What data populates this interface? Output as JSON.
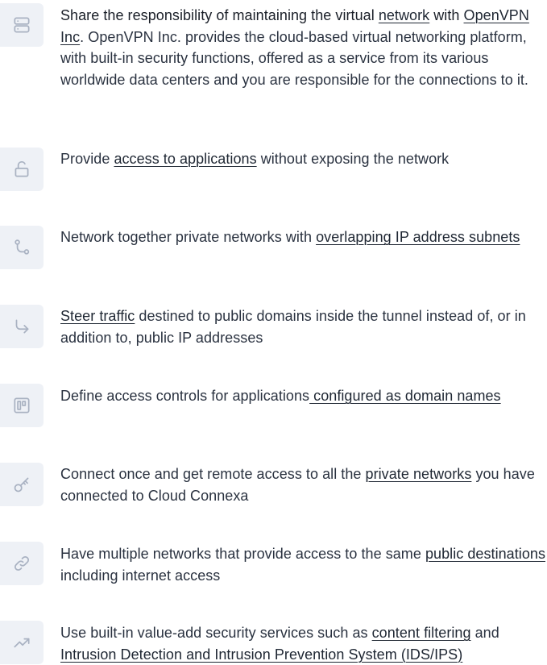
{
  "features": [
    {
      "icon": "server-icon",
      "parts": {
        "p1": "Share the responsibility of maintaining the virtual ",
        "l1": "network",
        "p2": " with ",
        "l2": "OpenVPN Inc",
        "p3": ". OpenVPN Inc. provides the cloud-based virtual networking platform, with built-in security functions, offered as a service from its various worldwide data centers and you are responsible for the connections to it."
      }
    },
    {
      "icon": "unlock-icon",
      "parts": {
        "p1": "Provide ",
        "l1": "access to applications",
        "p2": " without exposing the network"
      }
    },
    {
      "icon": "route-icon",
      "parts": {
        "p1": "Network together private networks with ",
        "l1": "overlapping IP address subnets"
      }
    },
    {
      "icon": "corner-down-right-icon",
      "parts": {
        "l1": "Steer traffic",
        "p1": " destined to public domains inside the tunnel instead of, or in addition to, public IP addresses"
      }
    },
    {
      "icon": "board-icon",
      "parts": {
        "p1": "Define access controls for applications",
        "l1": " configured as domain names"
      }
    },
    {
      "icon": "key-icon",
      "parts": {
        "p1": "Connect once and get remote access to all the ",
        "l1": "private networks",
        "p2": " you have connected to Cloud Connexa"
      }
    },
    {
      "icon": "link-icon",
      "parts": {
        "p1": "Have multiple networks that provide access to the same ",
        "l1": "public destinations",
        "p2": " including internet access"
      }
    },
    {
      "icon": "trending-up-icon",
      "parts": {
        "p1": "Use built-in value-add security services such as ",
        "l1": "content filtering",
        "p2": " and ",
        "l2": "Intrusion Detection and Intrusion Prevention System (IDS/IPS)"
      }
    }
  ]
}
